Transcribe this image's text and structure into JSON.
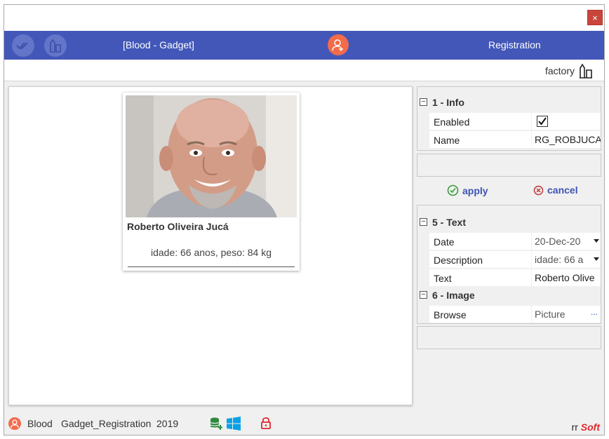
{
  "window": {
    "close_glyph": "×"
  },
  "appbar": {
    "left_title": "[Blood - Gadget]",
    "right_title": "Registration",
    "color": "#4257b8"
  },
  "subbar": {
    "factory_label": "factory"
  },
  "card": {
    "name": "Roberto Oliveira Jucá",
    "description": "idade: 66 anos, peso: 84 kg"
  },
  "properties": {
    "group1": {
      "label": "1 - Info",
      "rows": [
        {
          "name": "Enabled",
          "checked": true
        },
        {
          "name": "Name",
          "value": "RG_ROBJUCA"
        }
      ]
    },
    "actions": {
      "apply": "apply",
      "cancel": "cancel"
    },
    "group5": {
      "label": "5 - Text",
      "rows": [
        {
          "name": "Date",
          "value": "20-Dec-20"
        },
        {
          "name": "Description",
          "value": "idade: 66 a"
        },
        {
          "name": "Text",
          "value": "Roberto Olive"
        }
      ]
    },
    "group6": {
      "label": "6 - Image",
      "rows": [
        {
          "name": "Browse",
          "value": "Picture",
          "button": "..."
        }
      ]
    }
  },
  "statusbar": {
    "user": "Blood",
    "module": "Gadget_Registration",
    "year": "2019",
    "brand_prefix": "rr",
    "brand_suffix": "Soft"
  }
}
